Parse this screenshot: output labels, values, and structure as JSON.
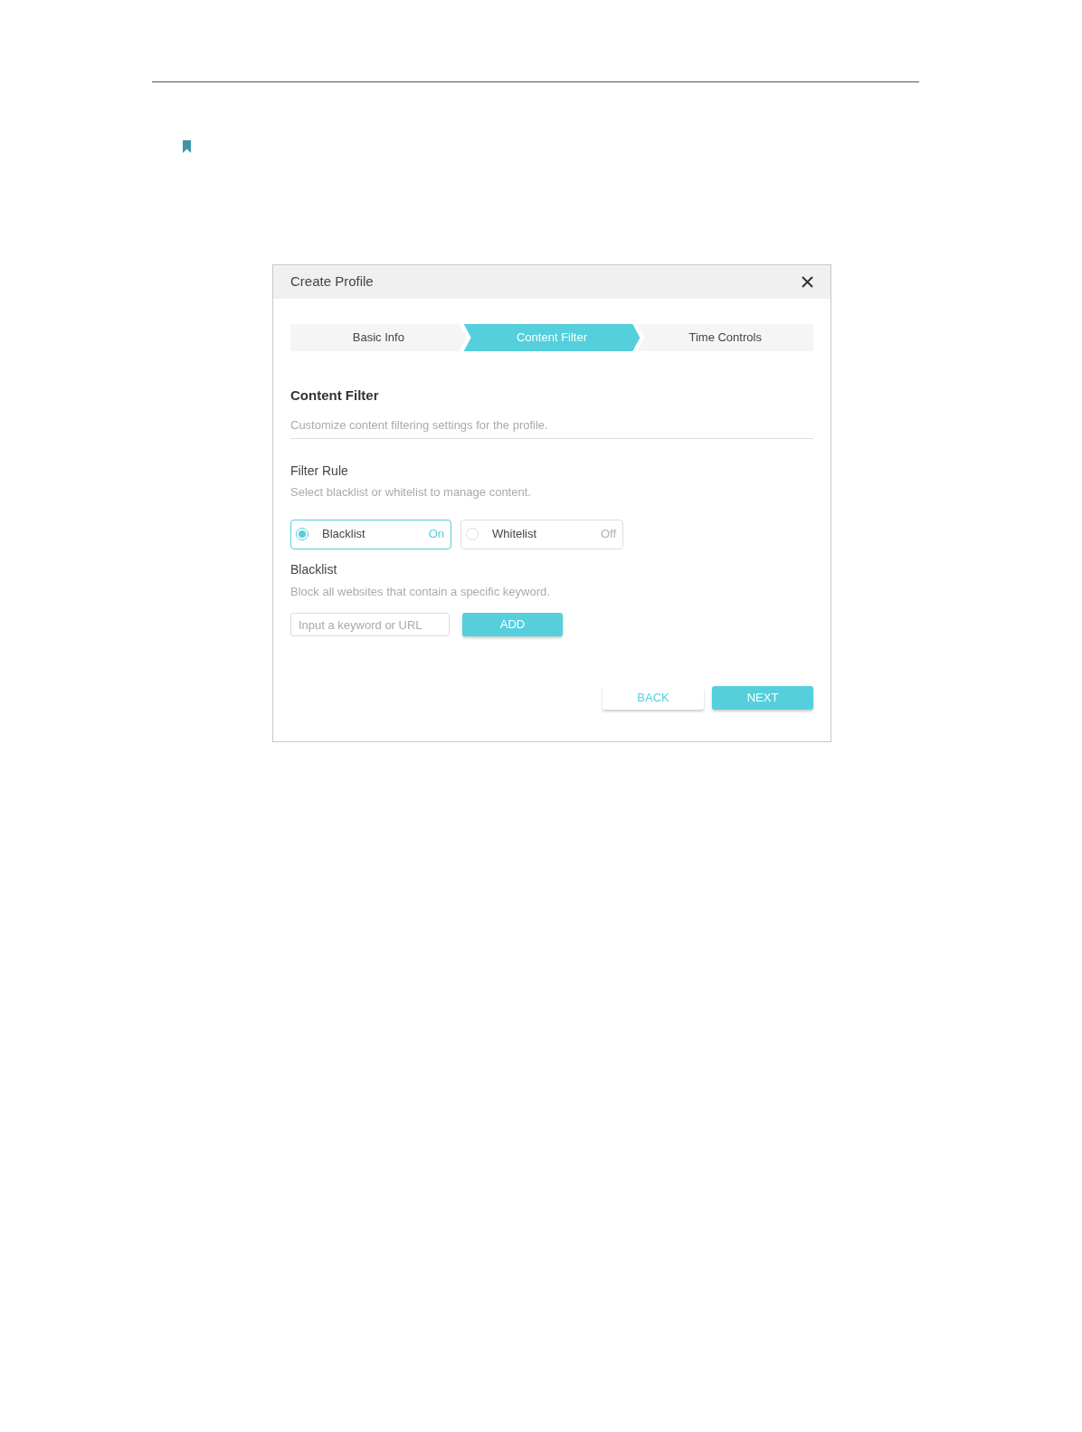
{
  "dialog": {
    "title": "Create Profile",
    "steps": [
      {
        "label": "Basic Info",
        "selected": false
      },
      {
        "label": "Content Filter",
        "selected": true
      },
      {
        "label": "Time Controls",
        "selected": false
      }
    ],
    "section": {
      "title": "Content Filter",
      "description": "Customize content filtering settings for the profile."
    },
    "filter_rule": {
      "title": "Filter Rule",
      "description": "Select blacklist or whitelist to manage content.",
      "options": [
        {
          "label": "Blacklist",
          "status": "On",
          "selected": true
        },
        {
          "label": "Whitelist",
          "status": "Off",
          "selected": false
        }
      ]
    },
    "list": {
      "title": "Blacklist",
      "description": "Block all websites that contain a specific keyword.",
      "input": {
        "placeholder": "Input a keyword or URL"
      },
      "add_button": "ADD"
    },
    "buttons": [
      {
        "label": "BACK",
        "kind": "secondary"
      },
      {
        "label": "NEXT",
        "kind": "primary"
      }
    ]
  }
}
